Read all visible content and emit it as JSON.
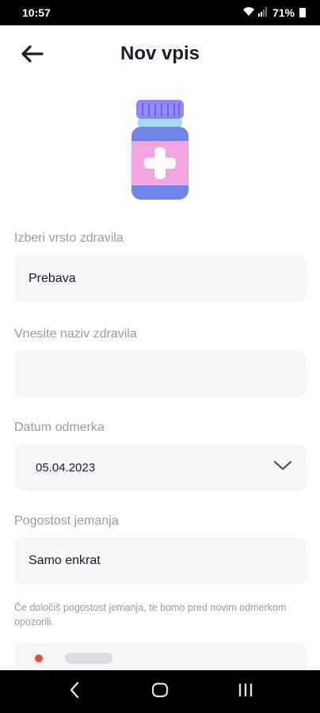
{
  "status_bar": {
    "time": "10:57",
    "battery": "71%",
    "icons": [
      "wifi-icon",
      "signal-icon",
      "battery-icon"
    ]
  },
  "header": {
    "title": "Nov vpis",
    "back_icon": "arrow-left-icon"
  },
  "illustration": {
    "icon": "medicine-bottle-icon",
    "colors": {
      "cap": "#8e88f0",
      "neck": "#a8d8f0",
      "body": "#6f86e8",
      "label": "#f0a6e0",
      "cross": "#ffffff"
    }
  },
  "form": {
    "medicine_type": {
      "label": "Izberi vrsto zdravila",
      "value": "Prebava"
    },
    "medicine_name": {
      "label": "Vnesite naziv zdravila",
      "value": ""
    },
    "dose_date": {
      "label": "Datum odmerka",
      "value": "05.04.2023",
      "icon": "chevron-down-icon"
    },
    "frequency": {
      "label": "Pogostost jemanja",
      "value": "Samo enkrat"
    },
    "hint": "Če določiš pogostost jemanja, te bomo pred novim odmerkom opozorili."
  },
  "nav_bar": {
    "buttons": [
      "back-nav-icon",
      "home-nav-icon",
      "recents-nav-icon"
    ]
  },
  "colors": {
    "field_bg": "#f5f6f8",
    "label": "#9a9aa6",
    "text": "#1c1c2e"
  }
}
